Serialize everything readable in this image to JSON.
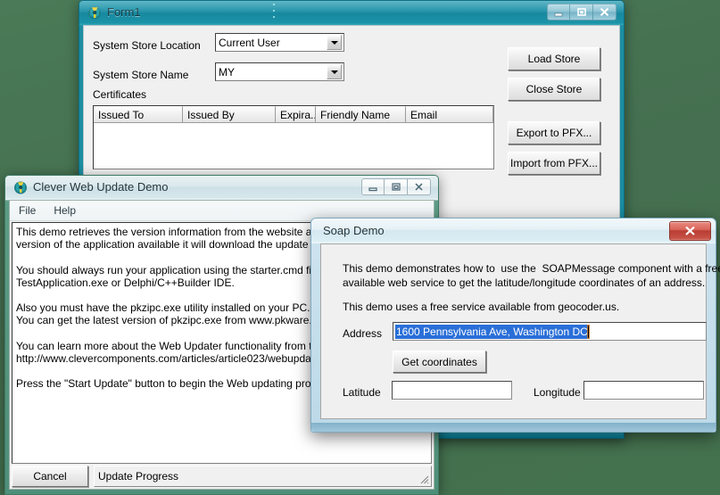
{
  "desktop": {
    "background_color": "#44714e"
  },
  "windows": {
    "form1": {
      "title": "Form1",
      "icon": "delphi-app-icon",
      "caption_buttons": {
        "minimize": "minimize-icon",
        "maximize": "maximize-icon",
        "close": "close-icon"
      },
      "labels": {
        "store_location": "System Store Location",
        "store_name": "System Store Name",
        "certificates": "Certificates"
      },
      "combos": {
        "store_location_value": "Current User",
        "store_name_value": "MY"
      },
      "list_columns": [
        "Issued To",
        "Issued By",
        "Expira...",
        "Friendly Name",
        "Email"
      ],
      "list_rows": [],
      "buttons": {
        "load_store": "Load Store",
        "close_store": "Close Store",
        "export_pfx": "Export to PFX...",
        "import_pfx": "Import from PFX..."
      }
    },
    "web_update": {
      "title": "Clever Web Update Demo",
      "icon": "delphi-app-icon",
      "menu": [
        "File",
        "Help"
      ],
      "memo_text": "This demo retrieves the version information from the website and if there is a newer\nversion of the application available it will download the update files and install them.\n\nYou should always run your application using the starter.cmd file and not from the\nTestApplication.exe or Delphi/C++Builder IDE.\n\nAlso you must have the pkzipc.exe utility installed on your PC.\nYou can get the latest version of pkzipc.exe from www.pkware.com\n\nYou can learn more about the Web Updater functionality from the article:\nhttp://www.clevercomponents.com/articles/article023/webupdater2.asp\n\nPress the \"Start Update\" button to begin the Web updating process.",
      "cancel_button": "Cancel",
      "progress_label": "Update Progress"
    },
    "soap_demo": {
      "title": "Soap Demo",
      "close_button": "close-icon",
      "paragraph_1": "This demo demonstrates how to  use the  SOAPMessage component with a freely\navailable web service to get the latitude/longitude coordinates of an address.",
      "paragraph_2": "This demo uses a free service available from geocoder.us.",
      "address_label": "Address",
      "address_value": "1600 Pennsylvania Ave, Washington DC",
      "get_coordinates_button": "Get coordinates",
      "latitude_label": "Latitude",
      "latitude_value": "",
      "longitude_label": "Longitude",
      "longitude_value": ""
    }
  }
}
